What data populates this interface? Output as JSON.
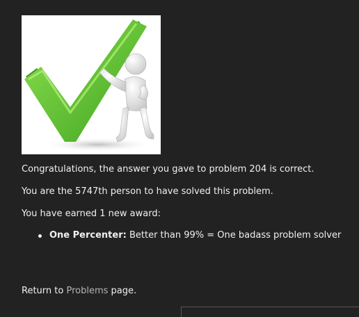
{
  "image": {
    "icon": "green-checkmark-with-figure-illustration"
  },
  "messages": {
    "congrats": "Congratulations, the answer you gave to problem 204 is correct.",
    "solver_rank": "You are the 5747th person to have solved this problem.",
    "awards_intro": "You have earned 1 new award:"
  },
  "awards": [
    {
      "name": "One Percenter:",
      "description": "Better than 99% = One badass problem solver"
    }
  ],
  "footer": {
    "return_prefix": "Return to",
    "return_link": "Problems",
    "return_suffix": "page."
  },
  "colors": {
    "background": "#222222",
    "text": "#f0f0f0",
    "link": "#b4b4b4",
    "check_green": "#5cc63a"
  }
}
